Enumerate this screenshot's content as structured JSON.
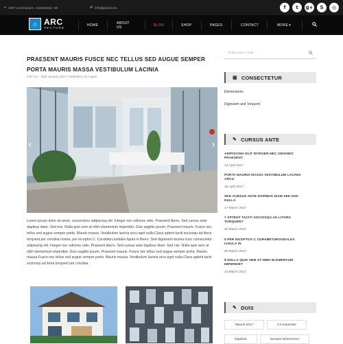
{
  "topbar": {
    "address": "1007 Lorem ipsum, Consectetur, AB",
    "email": "info@gmail.com",
    "social": [
      {
        "icon": "facebook-icon",
        "glyph": "f"
      },
      {
        "icon": "twitter-icon",
        "glyph": "t"
      },
      {
        "icon": "google-plus-icon",
        "glyph": "g+"
      },
      {
        "icon": "skype-icon",
        "glyph": "S"
      },
      {
        "icon": "instagram-icon",
        "glyph": "◎"
      }
    ]
  },
  "logo": {
    "line1": "ARC",
    "line2": "TECTURE"
  },
  "nav": {
    "items": [
      "HOME",
      "ABOUT US",
      "BLOG",
      "SHOP",
      "PAGES",
      "CONTACT",
      "MORE"
    ],
    "active": "BLOG",
    "more_caret": "▾"
  },
  "article": {
    "title": "PRAESENT MAURIS FUSCE NEC TELLUS SED AUGUE SEMPER PORTA MAURIS MASSA VESTIBULUM LACINIA",
    "meta": "5:30 Am - 15th January 2017 | imperdiet | by Augue",
    "body": "Lorem ipsum dolor sit amet, consectetur adipiscing elit. Integer nec odionec odio. Praesent libero. Sed cursus ante dapibus diam. Sed nisi. Nulla quis sem at nibh elementum imperdiet. Duis sagittis ipsum. Praesent mauris. Fusce nec tellus sed augue semper porta. Mauris massa. Vestibulum lacinia arcu eget nulla.Class aptent taciti sociosqu ad litora torquent per conubia nostra, per inceptos C. Curabiturcusdales ligula in libero. Sed dignissim lacinia nunc consectetur adipiscing elit. Integer nec odionec odio. Praesent libero. Sed cursus ante dapibus diam. Sed nisi. Nulla quis sem at nibh elementum imperdiet. Duis sagittis ipsum. Praesent mauris. Fusce nec tellus sed augue semper porta. Mauris massa.Fusce nec tellus sed augue semper porta. Mauris massa. Vestibulum lacinia arcu eget nulla.Class aptent taciti sociosqu ad litora torquent per conubia."
  },
  "sidebar": {
    "search_placeholder": "Enter your e mail",
    "categories_title": "CONSECTETUR",
    "categories": [
      "Elementums",
      "Dignissim and Torquent"
    ],
    "recent_title": "CURSUS ANTE",
    "recent_posts": [
      {
        "title": "ADIPISCING ELIT INTEGER NEC ODIONEC PRAESENT",
        "date": "12 April 2017"
      },
      {
        "title": "PORTA MAURIS MASSA VESTIBULUM LACINIA ARCU",
        "date": "15 April 2017"
      },
      {
        "title": "SED CURSUS ANTE DAPIBUS DIAM SED NISI NULLA",
        "date": "17 March 2017"
      },
      {
        "title": "7 APTENT TACITI SOCIOSQU AD LITORA TORQUENT",
        "date": "22 March 2017"
      },
      {
        "title": "5 PER INCEPTOS C CURABETURSODALES LIGULA IN",
        "date": "20 March 2017"
      },
      {
        "title": "8 NULLA QUIS SEM AT NIBH ELEMENTUM IMPERDIET",
        "date": "22 March 2017"
      }
    ],
    "tags_title": "DUIS",
    "tags": [
      "Mauris 2017",
      "Co-imperdiet",
      "Dapibus",
      "Semper Elementum"
    ]
  },
  "colors": {
    "accent": "#e06b2f",
    "logo": "#1d86c9",
    "topbar": "#1a1a1a",
    "navbar": "#0a0a0a"
  }
}
